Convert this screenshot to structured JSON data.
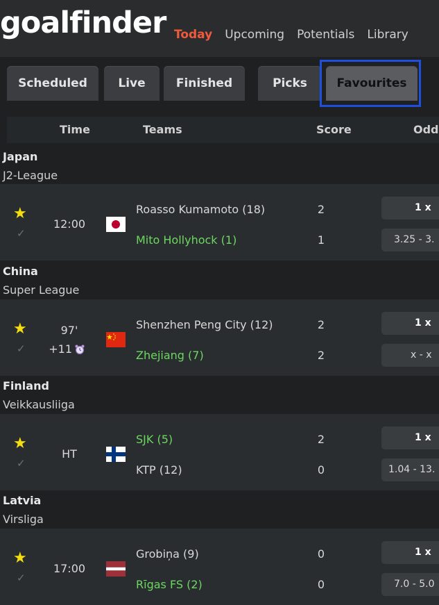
{
  "app": {
    "logo": "goalfinder"
  },
  "nav": [
    {
      "label": "Today",
      "active": true
    },
    {
      "label": "Upcoming",
      "active": false
    },
    {
      "label": "Potentials",
      "active": false
    },
    {
      "label": "Library",
      "active": false
    }
  ],
  "tabs": [
    {
      "label": "Scheduled"
    },
    {
      "label": "Live"
    },
    {
      "label": "Finished"
    },
    {
      "label": "Picks"
    },
    {
      "label": "Favourites",
      "selected": true
    }
  ],
  "columns": {
    "time": "Time",
    "teams": "Teams",
    "score": "Score",
    "odds": "Odds"
  },
  "sections": [
    {
      "country": "Japan",
      "league": "J2-League",
      "match": {
        "time": "12:00",
        "extra": "",
        "flag": "japan-flag",
        "home": {
          "name": "Roasso Kumamoto (18)",
          "score": "2"
        },
        "away": {
          "name": "Mito Hollyhock (1)",
          "score": "1"
        },
        "odds_top": "1  x",
        "odds_bottom": "3.25  -  3."
      }
    },
    {
      "country": "China",
      "league": "Super League",
      "match": {
        "time": "97'",
        "extra": "+11",
        "flag": "china-flag",
        "home": {
          "name": "Shenzhen Peng City (12)",
          "score": "2"
        },
        "away": {
          "name": "Zhejiang (7)",
          "score": "2"
        },
        "odds_top": "1  x",
        "odds_bottom": "x  -  x"
      }
    },
    {
      "country": "Finland",
      "league": "Veikkausliiga",
      "match": {
        "time": "HT",
        "extra": "",
        "flag": "finland-flag",
        "home": {
          "name": "SJK (5)",
          "score": "2"
        },
        "away": {
          "name": "KTP (12)",
          "score": "0"
        },
        "odds_top": "1  x",
        "odds_bottom": "1.04  -  13."
      }
    },
    {
      "country": "Latvia",
      "league": "Virsliga",
      "match": {
        "time": "17:00",
        "extra": "",
        "flag": "latvia-flag",
        "home": {
          "name": "Grobiņa (9)",
          "score": "0"
        },
        "away": {
          "name": "Rīgas FS (2)",
          "score": "0"
        },
        "odds_top": "1  x",
        "odds_bottom": "7.0  -  5.0"
      }
    }
  ],
  "colors": {
    "accent": "#ef5a3c",
    "winner": "#6cd860",
    "star": "#f6dd10",
    "highlight": "#1f4fe0"
  }
}
